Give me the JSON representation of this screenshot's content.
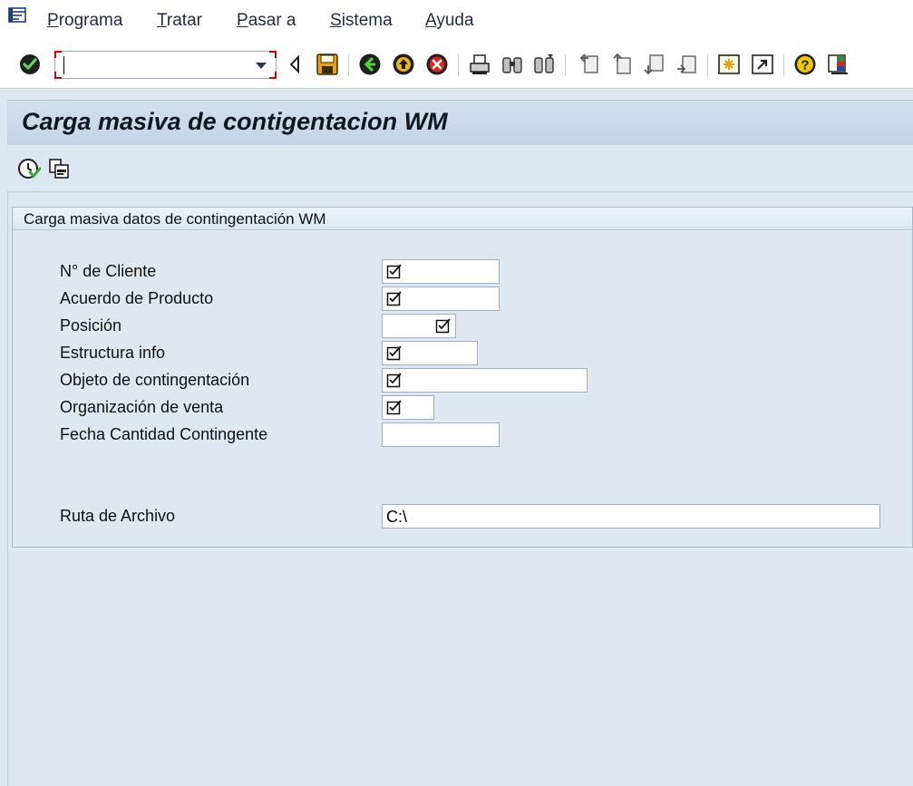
{
  "menu": {
    "icon": "menu-list-icon",
    "items": [
      {
        "label": "Programa",
        "underline": "P",
        "rest": "rograma"
      },
      {
        "label": "Tratar",
        "underline": "T",
        "rest": "ratar"
      },
      {
        "label": "Pasar a",
        "underline": "P",
        "rest": "asar a"
      },
      {
        "label": "Sistema",
        "underline": "S",
        "rest": "istema"
      },
      {
        "label": "Ayuda",
        "underline": "A",
        "rest": "yuda"
      }
    ]
  },
  "toolbar": {
    "command_field_value": "",
    "icons": [
      "enter-icon",
      "back-triangle-icon",
      "save-icon",
      "back-icon",
      "exit-icon",
      "cancel-icon",
      "print-icon",
      "find-icon",
      "find-next-icon",
      "first-page-icon",
      "previous-page-icon",
      "next-page-icon",
      "last-page-icon",
      "new-session-icon",
      "create-shortcut-icon",
      "help-icon",
      "customize-layout-icon"
    ]
  },
  "title": "Carga masiva de contigentacion WM",
  "app_toolbar": {
    "icons": [
      "execute-icon",
      "variants-icon"
    ]
  },
  "group": {
    "title": "Carga masiva datos de contingentación WM"
  },
  "form": {
    "fields": [
      {
        "label": "N° de Cliente",
        "value": "",
        "required": true
      },
      {
        "label": "Acuerdo de Producto",
        "value": "",
        "required": true
      },
      {
        "label": "Posición",
        "value": "",
        "required": true
      },
      {
        "label": "Estructura info",
        "value": "",
        "required": true
      },
      {
        "label": "Objeto de contingentación",
        "value": "",
        "required": true
      },
      {
        "label": "Organización de venta",
        "value": "",
        "required": true
      },
      {
        "label": "Fecha Cantidad Contingente",
        "value": "",
        "required": false
      }
    ],
    "file_path": {
      "label": "Ruta de Archivo",
      "value": "C:\\"
    }
  },
  "colors": {
    "background": "#dfe8f1",
    "title_bar": "#c9d9ea",
    "enter_green": "#2f9a2f",
    "cancel_red": "#c8201c",
    "help_yellow": "#f2c40c"
  }
}
